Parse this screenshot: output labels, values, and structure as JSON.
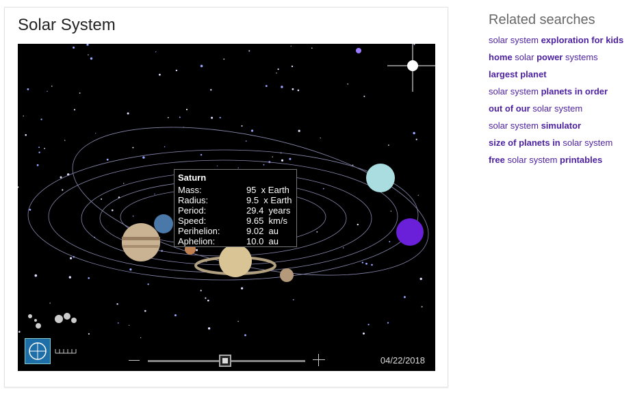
{
  "panel": {
    "title": "Solar System"
  },
  "tooltip": {
    "title": "Saturn",
    "rows": [
      {
        "label": "Mass:",
        "value": "95  x Earth"
      },
      {
        "label": "Radius:",
        "value": "9.5  x Earth"
      },
      {
        "label": "Period:",
        "value": "29.4  years"
      },
      {
        "label": "Speed:",
        "value": "9.65  km/s"
      },
      {
        "label": "Perihelion:",
        "value": "9.02  au"
      },
      {
        "label": "Aphelion:",
        "value": "10.0  au"
      }
    ]
  },
  "timeline": {
    "date": "04/22/2018",
    "position": 0.5
  },
  "related": {
    "heading": "Related searches",
    "links": [
      [
        {
          "t": "solar system ",
          "b": false
        },
        {
          "t": "exploration for kids",
          "b": true
        }
      ],
      [
        {
          "t": "home",
          "b": true
        },
        {
          "t": " solar ",
          "b": false
        },
        {
          "t": "power",
          "b": true
        },
        {
          "t": " systems",
          "b": false
        }
      ],
      [
        {
          "t": "largest planet",
          "b": true
        }
      ],
      [
        {
          "t": "solar system ",
          "b": false
        },
        {
          "t": "planets in order",
          "b": true
        }
      ],
      [
        {
          "t": "out of our",
          "b": true
        },
        {
          "t": " solar system",
          "b": false
        }
      ],
      [
        {
          "t": "solar system ",
          "b": false
        },
        {
          "t": "simulator",
          "b": true
        }
      ],
      [
        {
          "t": "size of planets in",
          "b": true
        },
        {
          "t": " solar system",
          "b": false
        }
      ],
      [
        {
          "t": "free",
          "b": true
        },
        {
          "t": " solar system ",
          "b": false
        },
        {
          "t": "printables",
          "b": true
        }
      ]
    ]
  },
  "colors": {
    "link": "#4b1fa0",
    "background_space": "#000000"
  }
}
